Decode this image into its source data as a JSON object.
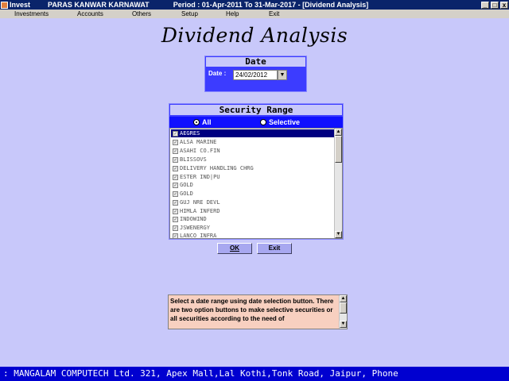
{
  "titlebar": {
    "app_name": "Invest",
    "user": "PARAS KANWAR KARNAWAT",
    "period": "Period : 01-Apr-2011  To  31-Mar-2017 - [Dividend Analysis]",
    "minimize": "_",
    "restore": "□",
    "close": "x"
  },
  "menu": [
    "Investments",
    "Accounts",
    "Others",
    "Setup",
    "Help",
    "Exit"
  ],
  "page_title": "Dividend Analysis",
  "date_panel": {
    "header": "Date",
    "label": "Date :",
    "value": "24/02/2012",
    "dropdown_glyph": "▼"
  },
  "security_range": {
    "header": "Security Range",
    "option_all": "All",
    "option_selective": "Selective",
    "selected_option": "All",
    "items": [
      "AEGRES",
      "ALSA MARINE",
      "ASAHI CO.FIN",
      "BLISSOVS",
      "DELIVERY HANDLING CHRG",
      "ESTER IND|PU",
      "GOLD",
      "GOLD",
      "GUJ NRE DEVL",
      "HIMLA INFERD",
      "INDOWIND",
      "JSWENERGY",
      "LANCO INFRA"
    ],
    "selected_index": 0
  },
  "buttons": {
    "ok": "OK",
    "exit": "Exit"
  },
  "help": {
    "text": "Select a date range using date selection button. There are two option buttons to make selective securities or all securities according to the need of"
  },
  "statusbar": {
    "text": ": MANGALAM COMPUTECH Ltd. 321, Apex Mall,Lal Kothi,Tonk Road, Jaipur, Phone"
  },
  "colors": {
    "background": "#c8c8fa",
    "panel_blue": "#3c3cff",
    "title_blue": "#0a246a",
    "status_blue": "#0000d0",
    "help_bg": "#f8d0c0"
  }
}
